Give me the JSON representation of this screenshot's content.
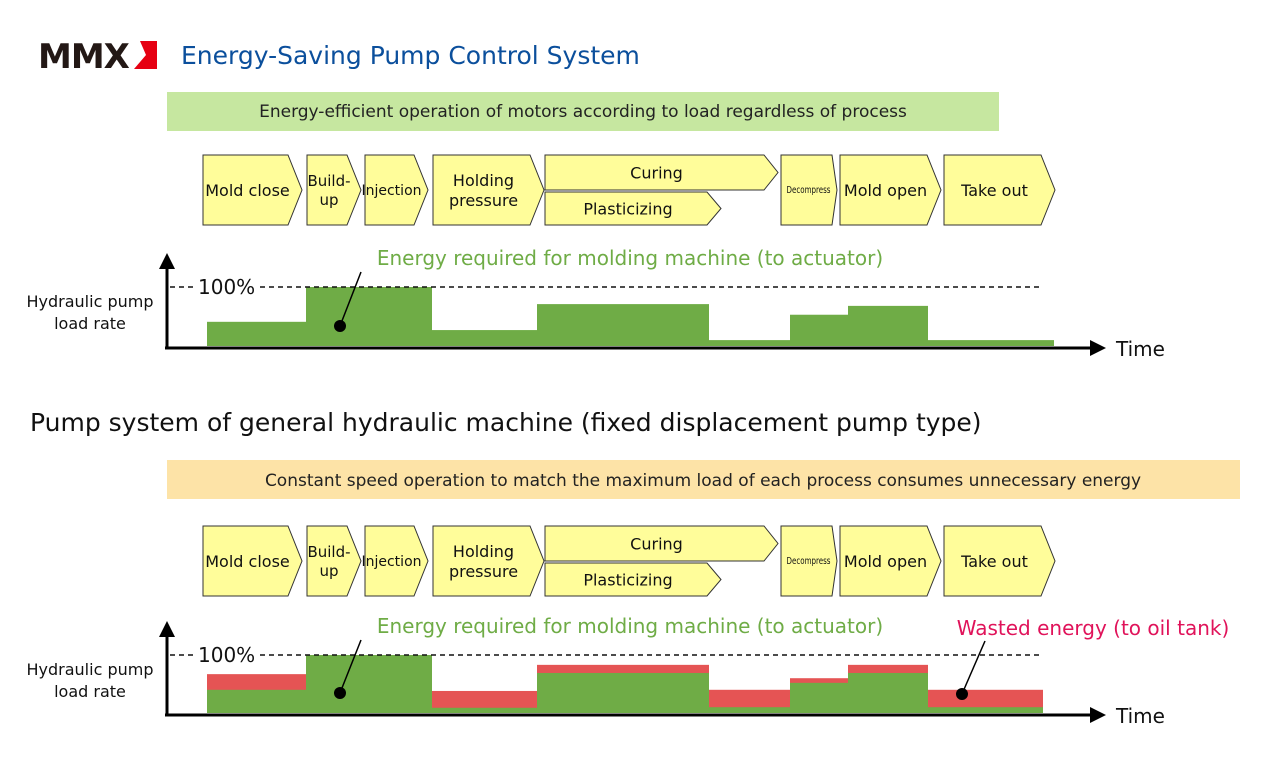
{
  "logo": {
    "text": "MMX",
    "colors": {
      "text": "#231815",
      "mark": "#e60012"
    }
  },
  "title": "Energy-Saving Pump Control System",
  "colors": {
    "title": "#0b4f9c",
    "green_banner": "#c6e7a0",
    "orange_banner": "#fde3a7",
    "process_fill": "#fffd9a",
    "required": "#6fac46",
    "wasted": "#e55454",
    "required_label": "#6fac46",
    "wasted_label": "#e0135a"
  },
  "processes": [
    {
      "id": "mold-close",
      "lines": [
        "Mold close"
      ]
    },
    {
      "id": "build-up",
      "lines": [
        "Build-",
        "up"
      ]
    },
    {
      "id": "injection",
      "lines": [
        "Injection"
      ]
    },
    {
      "id": "holding-pressure",
      "lines": [
        "Holding",
        "pressure"
      ]
    },
    {
      "id": "curing",
      "lines": [
        "Curing"
      ]
    },
    {
      "id": "plasticizing",
      "lines": [
        "Plasticizing"
      ]
    },
    {
      "id": "decompress",
      "lines": [
        "Decompress"
      ]
    },
    {
      "id": "mold-open",
      "lines": [
        "Mold open"
      ]
    },
    {
      "id": "take-out",
      "lines": [
        "Take out"
      ]
    }
  ],
  "section1": {
    "banner": "Energy-efficient operation of motors according to load regardless of process",
    "ylabel": [
      "Hydraulic pump",
      "load rate"
    ],
    "ref_label": "100%",
    "xlabel": "Time",
    "required_label": "Energy required for molding machine (to actuator)",
    "required_load_percent": [
      41,
      100,
      27,
      71,
      10,
      53,
      68,
      10
    ]
  },
  "section2": {
    "heading": "Pump system of general hydraulic machine  (fixed displacement pump type)",
    "banner": "Constant speed operation to match the maximum load of each process consumes unnecessary energy",
    "ylabel": [
      "Hydraulic pump",
      "load rate"
    ],
    "ref_label": "100%",
    "xlabel": "Time",
    "required_label": "Energy required for molding machine (to actuator)",
    "wasted_label": "Wasted energy (to oil tank)",
    "required_load_percent": [
      40,
      100,
      9,
      69,
      10,
      52,
      69,
      10
    ],
    "total_load_percent": [
      67,
      100,
      38,
      83,
      40,
      60,
      83,
      40
    ]
  }
}
